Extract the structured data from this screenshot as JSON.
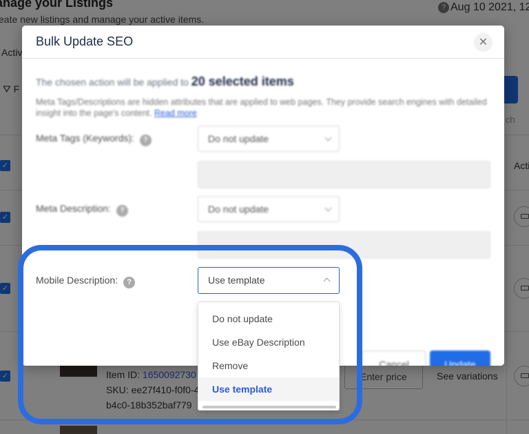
{
  "background": {
    "page_title": "anage your Listings",
    "page_subtitle": "eate new listings and manage your active items.",
    "date_text": "Aug 10 2021, 12",
    "tab_label": "Activ",
    "filter_label": "F",
    "search_placeholder": "ch",
    "actions_header": "Acti",
    "item_id_label": "Item ID:",
    "item_id_value": "1650092730",
    "sku_line1": "SKU: ee27f410-f0f0-4",
    "sku_line2": "b4c0-18b352baf779",
    "enter_price": "Enter price",
    "see_variations": "See variations"
  },
  "modal": {
    "title": "Bulk Update SEO",
    "close_glyph": "✕",
    "intro_text": "The chosen action will be applied to",
    "selected_count": "20 selected items",
    "description": "Meta Tags/Descriptions are hidden attributes that are applied to web pages. They provide search engines with detailed insight into the page's content.",
    "read_more": "Read more",
    "fields": {
      "meta_tags": {
        "label": "Meta Tags (Keywords):",
        "value": "Do not update"
      },
      "meta_description": {
        "label": "Meta Description:",
        "value": "Do not update"
      },
      "mobile_description": {
        "label": "Mobile Description:",
        "value": "Use template"
      }
    },
    "dropdown_options": [
      "Do not update",
      "Use eBay Description",
      "Remove",
      "Use template"
    ],
    "cancel_label": "Cancel",
    "update_label": "Update"
  },
  "colors": {
    "accent": "#1f6ee8",
    "highlight_ring": "#2b6de0",
    "title": "#1e2a48"
  }
}
